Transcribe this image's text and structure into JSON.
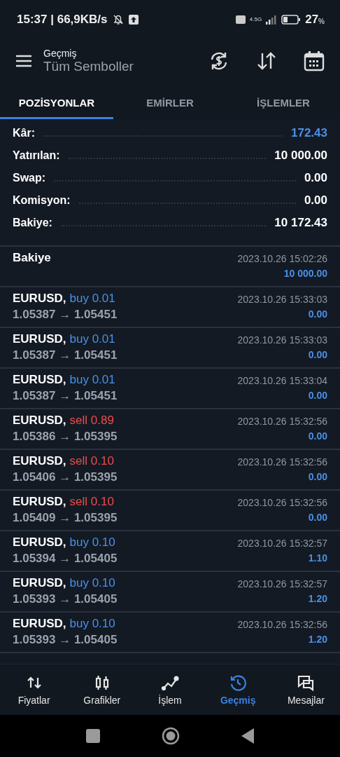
{
  "status_bar": {
    "time": "15:37 | 66,9KB/s",
    "network": "4.5G",
    "battery": "27",
    "battery_unit": "%"
  },
  "header": {
    "subtitle": "Geçmiş",
    "title": "Tüm Semboller"
  },
  "tabs": [
    {
      "label": "POZİSYONLAR",
      "selected": true
    },
    {
      "label": "EMİRLER",
      "selected": false
    },
    {
      "label": "İŞLEMLER",
      "selected": false
    }
  ],
  "summary": [
    {
      "label": "Kâr:",
      "value": "172.43",
      "highlight": true
    },
    {
      "label": "Yatırılan:",
      "value": "10 000.00",
      "highlight": false
    },
    {
      "label": "Swap:",
      "value": "0.00",
      "highlight": false
    },
    {
      "label": "Komisyon:",
      "value": "0.00",
      "highlight": false
    },
    {
      "label": "Bakiye:",
      "value": "10 172.43",
      "highlight": false
    }
  ],
  "deals": [
    {
      "kind": "balance",
      "symbol": "Bakiye",
      "time": "2023.10.26 15:02:26",
      "profit": "10 000.00"
    },
    {
      "kind": "buy",
      "symbol": "EURUSD,",
      "side": "buy 0.01",
      "prices": "1.05387 → 1.05451",
      "time": "2023.10.26 15:33:03",
      "profit": "0.00"
    },
    {
      "kind": "buy",
      "symbol": "EURUSD,",
      "side": "buy 0.01",
      "prices": "1.05387 → 1.05451",
      "time": "2023.10.26 15:33:03",
      "profit": "0.00"
    },
    {
      "kind": "buy",
      "symbol": "EURUSD,",
      "side": "buy 0.01",
      "prices": "1.05387 → 1.05451",
      "time": "2023.10.26 15:33:04",
      "profit": "0.00"
    },
    {
      "kind": "sell",
      "symbol": "EURUSD,",
      "side": "sell 0.89",
      "prices": "1.05386 → 1.05395",
      "time": "2023.10.26 15:32:56",
      "profit": "0.00"
    },
    {
      "kind": "sell",
      "symbol": "EURUSD,",
      "side": "sell 0.10",
      "prices": "1.05406 → 1.05395",
      "time": "2023.10.26 15:32:56",
      "profit": "0.00"
    },
    {
      "kind": "sell",
      "symbol": "EURUSD,",
      "side": "sell 0.10",
      "prices": "1.05409 → 1.05395",
      "time": "2023.10.26 15:32:56",
      "profit": "0.00"
    },
    {
      "kind": "buy",
      "symbol": "EURUSD,",
      "side": "buy 0.10",
      "prices": "1.05394 → 1.05405",
      "time": "2023.10.26 15:32:57",
      "profit": "1.10"
    },
    {
      "kind": "buy",
      "symbol": "EURUSD,",
      "side": "buy 0.10",
      "prices": "1.05393 → 1.05405",
      "time": "2023.10.26 15:32:57",
      "profit": "1.20"
    },
    {
      "kind": "buy",
      "symbol": "EURUSD,",
      "side": "buy 0.10",
      "prices": "1.05393 → 1.05405",
      "time": "2023.10.26 15:32:56",
      "profit": "1.20"
    }
  ],
  "bottom_nav": [
    {
      "kind": "quotes",
      "label": "Fiyatlar",
      "selected": false
    },
    {
      "kind": "charts",
      "label": "Grafikler",
      "selected": false
    },
    {
      "kind": "trade",
      "label": "İşlem",
      "selected": false
    },
    {
      "kind": "history",
      "label": "Geçmiş",
      "selected": true
    },
    {
      "kind": "messages",
      "label": "Mesajlar",
      "selected": false
    }
  ]
}
